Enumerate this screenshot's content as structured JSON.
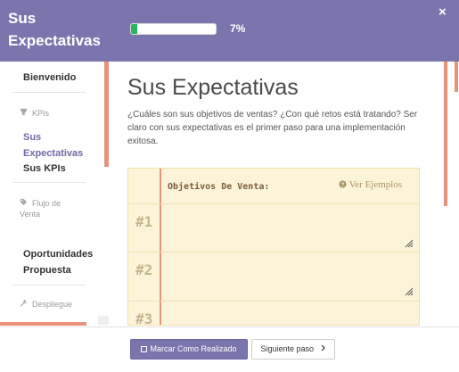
{
  "header": {
    "title": "Sus Expectativas",
    "progress_percent": 7,
    "progress_label": "7%",
    "close_label": "×"
  },
  "sidebar": {
    "welcome": "Bienvenido",
    "sections": [
      {
        "label": "KPIs",
        "icon": "trophy-icon",
        "items": [
          "Sus Expectativas",
          "Sus KPIs"
        ]
      },
      {
        "label": "Flujo de Venta",
        "icon": "tag-icon",
        "items": [
          "Oportunidades Propuesta"
        ]
      },
      {
        "label": "Despliegue",
        "icon": "wrench-icon",
        "items": []
      }
    ]
  },
  "main": {
    "title": "Sus Expectativas",
    "description": "¿Cuáles son sus objetivos de ventas? ¿Con qué retos está tratando? Ser claro con sus expectativas es el primer paso para una implementación exitosa.",
    "notebook": {
      "heading": "Objetivos De Venta:",
      "examples_link": "Ver Ejemplos",
      "numbers": [
        "#1",
        "#2",
        "#3"
      ]
    }
  },
  "footer": {
    "mark_done": "Marcar Como Realizado",
    "next_step": "Siguiente paso"
  },
  "colors": {
    "header": "#7a75ad",
    "accent": "#e8927a",
    "progress": "#28b463",
    "notebook_bg": "#fcf4d8"
  }
}
